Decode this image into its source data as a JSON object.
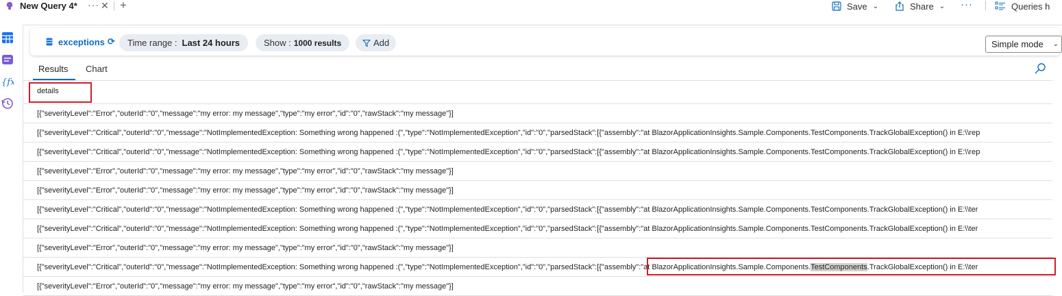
{
  "tab": {
    "title": "New Query 4*",
    "more": "···",
    "close": "✕",
    "add": "+"
  },
  "toolbar": {
    "save_label": "Save",
    "share_label": "Share",
    "more": "···",
    "queries_label": "Queries h"
  },
  "rail": {
    "icons": [
      "tables-icon",
      "queries-icon",
      "functions-icon",
      "history-icon"
    ]
  },
  "query_bar": {
    "source_label": "exceptions",
    "time_range_key": "Time range :",
    "time_range_value": "Last 24 hours",
    "show_key": "Show :",
    "show_value": "1000 results",
    "add_label": "Add",
    "mode_value": "Simple mode"
  },
  "results_tabs": [
    "Results",
    "Chart"
  ],
  "table": {
    "column_header": "details",
    "rows": [
      "[{\"severityLevel\":\"Error\",\"outerId\":\"0\",\"message\":\"my error: my message\",\"type\":\"my error\",\"id\":\"0\",\"rawStack\":\"my message\"}]",
      "[{\"severityLevel\":\"Critical\",\"outerId\":\"0\",\"message\":\"NotImplementedException: Something wrong happened :(\",\"type\":\"NotImplementedException\",\"id\":\"0\",\"parsedStack\":[{\"assembly\":\"at BlazorApplicationInsights.Sample.Components.TestComponents.TrackGlobalException() in E:\\\\rep",
      "[{\"severityLevel\":\"Critical\",\"outerId\":\"0\",\"message\":\"NotImplementedException: Something wrong happened :(\",\"type\":\"NotImplementedException\",\"id\":\"0\",\"parsedStack\":[{\"assembly\":\"at BlazorApplicationInsights.Sample.Components.TestComponents.TrackGlobalException() in E:\\\\rep",
      "[{\"severityLevel\":\"Error\",\"outerId\":\"0\",\"message\":\"my error: my message\",\"type\":\"my error\",\"id\":\"0\",\"rawStack\":\"my message\"}]",
      "[{\"severityLevel\":\"Error\",\"outerId\":\"0\",\"message\":\"my error: my message\",\"type\":\"my error\",\"id\":\"0\",\"rawStack\":\"my message\"}]",
      "[{\"severityLevel\":\"Critical\",\"outerId\":\"0\",\"message\":\"NotImplementedException: Something wrong happened :(\",\"type\":\"NotImplementedException\",\"id\":\"0\",\"parsedStack\":[{\"assembly\":\"at BlazorApplicationInsights.Sample.Components.TestComponents.TrackGlobalException() in E:\\\\ter",
      "[{\"severityLevel\":\"Critical\",\"outerId\":\"0\",\"message\":\"NotImplementedException: Something wrong happened :(\",\"type\":\"NotImplementedException\",\"id\":\"0\",\"parsedStack\":[{\"assembly\":\"at BlazorApplicationInsights.Sample.Components.TestComponents.TrackGlobalException() in E:\\\\ter",
      "[{\"severityLevel\":\"Error\",\"outerId\":\"0\",\"message\":\"my error: my message\",\"type\":\"my error\",\"id\":\"0\",\"rawStack\":\"my message\"}]"
    ],
    "highlight_row": {
      "prefix": "[{\"severityLevel\":\"Critical\",\"outerId\":\"0\",\"message\":\"NotImplementedException: Something wrong happened :(\",\"type\":\"NotImplementedException\",\"id\":\"0\",\"parsedStack\":[",
      "boxed_before": "{\"assembly\":\"at BlazorApplicationInsights.Sample.Components.",
      "selected": "TestComponents",
      "boxed_after": ".TrackGlobalException() in E:\\\\ter"
    },
    "last_row": "[{\"severityLevel\":\"Error\",\"outerId\":\"0\",\"message\":\"my error: my message\",\"type\":\"my error\",\"id\":\"0\",\"rawStack\":\"my message\"}]"
  },
  "colors": {
    "accent": "#0f6cbd",
    "highlight_border": "#d01c2a",
    "pill_bg": "#e8edf3"
  }
}
